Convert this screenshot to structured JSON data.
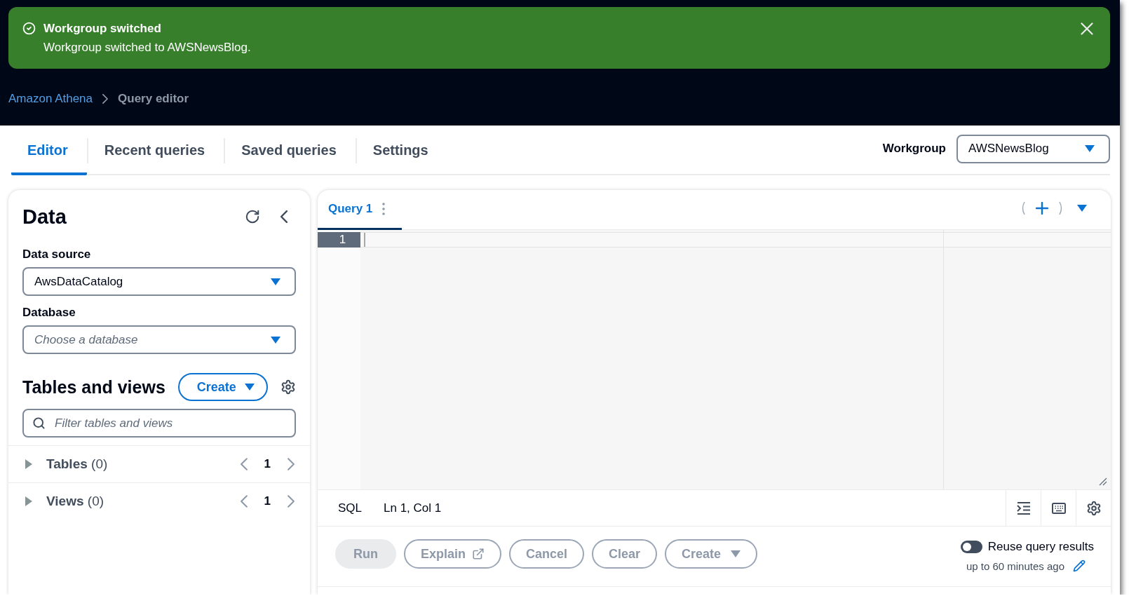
{
  "notification": {
    "title": "Workgroup switched",
    "message": "Workgroup switched to AWSNewsBlog."
  },
  "breadcrumbs": [
    {
      "label": "Amazon Athena",
      "current": false
    },
    {
      "label": "Query editor",
      "current": true
    }
  ],
  "tabs": [
    {
      "label": "Editor",
      "selected": true
    },
    {
      "label": "Recent queries",
      "selected": false
    },
    {
      "label": "Saved queries",
      "selected": false
    },
    {
      "label": "Settings",
      "selected": false
    }
  ],
  "workgroup": {
    "label": "Workgroup",
    "value": "AWSNewsBlog"
  },
  "data_panel": {
    "title": "Data",
    "fields": [
      {
        "label": "Data source",
        "value": "AwsDataCatalog"
      },
      {
        "label": "Database",
        "placeholder": "Choose a database"
      }
    ],
    "tables_and_views": {
      "title": "Tables and views",
      "create_button": "Create",
      "filter": {
        "placeholder": "Filter tables and views"
      },
      "sections": [
        {
          "label": "**Tables** (0)",
          "page": "1",
          "expanded": false
        },
        {
          "label": "**Views** (0)",
          "page": "1",
          "expanded": false
        }
      ]
    }
  },
  "editor": {
    "query_tabs": [
      {
        "label": "Query 1",
        "selected": true
      }
    ],
    "line_numbers": [
      "1"
    ],
    "language": "SQL",
    "cursor_position": "Ln 1, Col 1",
    "actions": [
      {
        "label": "Run",
        "kind": "primary",
        "disabled": true
      },
      {
        "label": "Explain",
        "kind": "external",
        "disabled": true
      },
      {
        "label": "Cancel",
        "kind": "normal",
        "disabled": true
      },
      {
        "label": "Clear",
        "kind": "normal",
        "disabled": true
      },
      {
        "label": "Create",
        "kind": "dropdown",
        "disabled": true
      }
    ],
    "reuse_results": {
      "label": "Reuse query results",
      "on": false,
      "detail": "up to 60 minutes ago"
    }
  }
}
